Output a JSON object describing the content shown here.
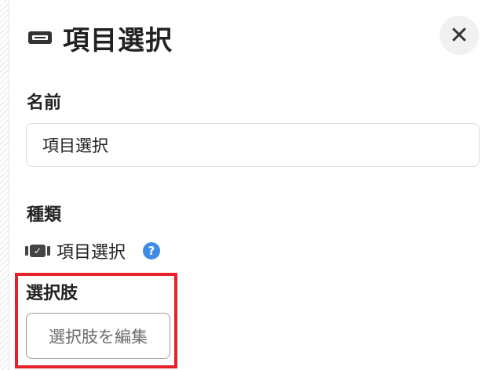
{
  "header": {
    "title": "項目選択",
    "close_label": "✕"
  },
  "fields": {
    "name": {
      "label": "名前",
      "value": "項目選択"
    },
    "type": {
      "label": "種類",
      "value": "項目選択",
      "help_label": "?"
    },
    "choices": {
      "label": "選択肢",
      "edit_button_label": "選択肢を編集"
    }
  },
  "colors": {
    "highlight_border": "#e8202a",
    "help_icon": "#3c8de3"
  }
}
